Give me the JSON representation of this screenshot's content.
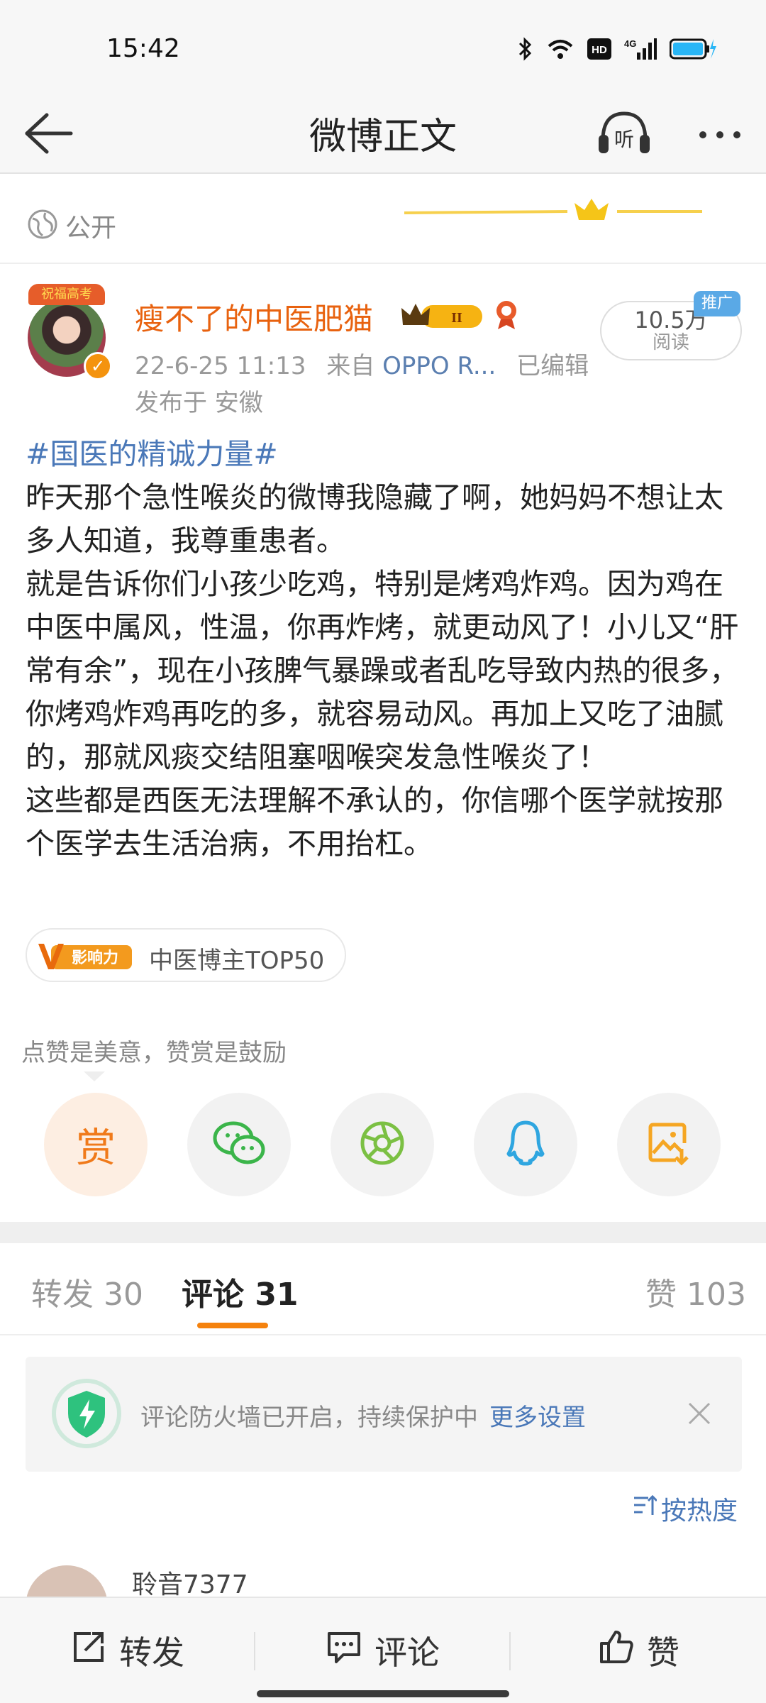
{
  "status_bar": {
    "time": "15:42",
    "icons": [
      "bluetooth-icon",
      "wifi-icon",
      "hd-icon",
      "signal-4g-icon",
      "battery-charging-icon"
    ],
    "hd_label": "HD",
    "network_label": "4G"
  },
  "nav": {
    "title": "微博正文",
    "listen_label": "听"
  },
  "visibility": {
    "label": "公开"
  },
  "author": {
    "banner_text": "祝福高考",
    "name": "瘦不了的中医肥猫",
    "level_badge": "II",
    "post_time": "22-6-25 11:13",
    "source_prefix": "来自",
    "source": "OPPO R...",
    "edited": "已编辑",
    "location": "发布于 安徽"
  },
  "reads": {
    "count": "10.5万",
    "label": "阅读",
    "promo": "推广"
  },
  "post": {
    "hashtag": "#国医的精诚力量#",
    "paragraphs": [
      "昨天那个急性喉炎的微博我隐藏了啊，她妈妈不想让太多人知道，我尊重患者。",
      "就是告诉你们小孩少吃鸡，特别是烤鸡炸鸡。因为鸡在中医中属风，性温，你再炸烤，就更动风了！小儿又“肝常有余”，现在小孩脾气暴躁或者乱吃导致内热的很多，你烤鸡炸鸡再吃的多，就容易动风。再加上又吃了油腻的，那就风痰交结阻塞咽喉突发急性喉炎了！",
      "这些都是西医无法理解不承认的，你信哪个医学就按那个医学去生活治病，不用抬杠。"
    ]
  },
  "influence": {
    "logo_text": "影响力",
    "label": "中医博主TOP50"
  },
  "reward": {
    "tip": "点赞是美意，赞赏是鼓励",
    "reward_glyph": "赏",
    "share_targets": [
      "reward-icon",
      "wechat-icon",
      "moments-icon",
      "qq-icon",
      "save-image-icon"
    ]
  },
  "tabs": {
    "repost": "转发 30",
    "comments": "评论 31",
    "likes": "赞 103"
  },
  "firewall": {
    "text": "评论防火墙已开启，持续保护中",
    "link": "更多设置"
  },
  "sort": {
    "label": "按热度"
  },
  "comment": {
    "user": "聆音7377"
  },
  "bottom_bar": {
    "repost": "转发",
    "comment": "评论",
    "like": "赞"
  },
  "colors": {
    "accent_orange": "#f5820e",
    "link_blue": "#4a78b8",
    "author_orange": "#e8620f"
  }
}
